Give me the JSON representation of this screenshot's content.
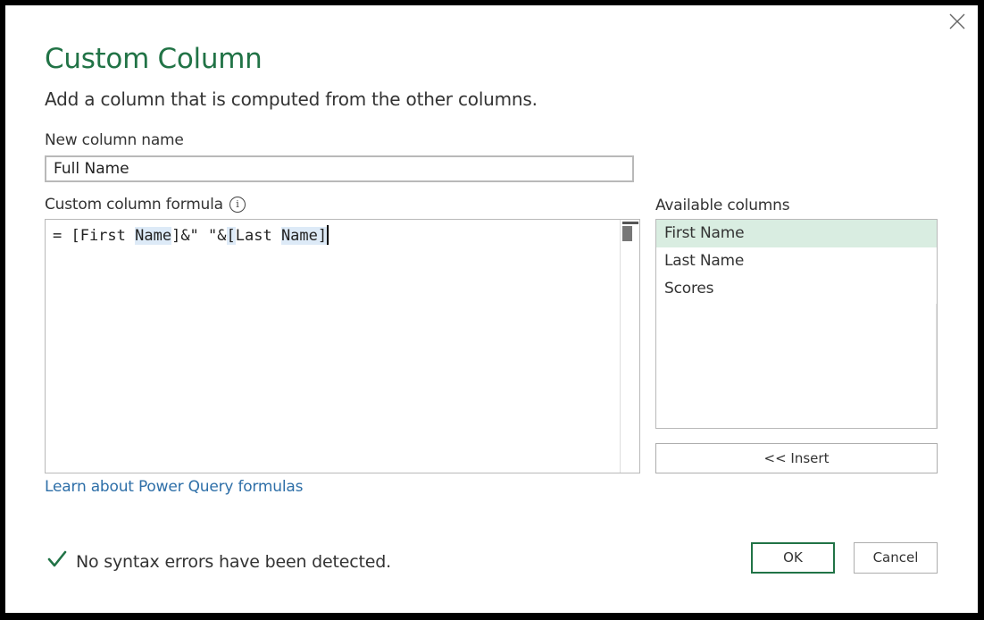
{
  "dialog": {
    "title": "Custom Column",
    "description": "Add a column that is computed from the other columns.",
    "new_column_label": "New column name",
    "new_column_value": "Full Name",
    "formula_label": "Custom column formula",
    "formula": {
      "prefix": "= [First ",
      "hl1": "Name",
      "mid": "]&\" \"&",
      "hl2": "[",
      "mid2": "Last ",
      "hl3": "Name",
      "hl4": "]"
    },
    "available_label": "Available columns",
    "available_columns": [
      "First Name",
      "Last Name",
      "Scores"
    ],
    "selected_column_index": 0,
    "insert_label": "<< Insert",
    "learn_link": "Learn about Power Query formulas",
    "status": "No syntax errors have been detected.",
    "ok_label": "OK",
    "cancel_label": "Cancel"
  },
  "icons": {
    "close": "close-icon",
    "info": "info-icon",
    "check": "check-icon"
  },
  "colors": {
    "accent": "#217346",
    "link": "#2e6fa8",
    "selection": "#d9ede1",
    "highlight": "#ddeaf7"
  }
}
